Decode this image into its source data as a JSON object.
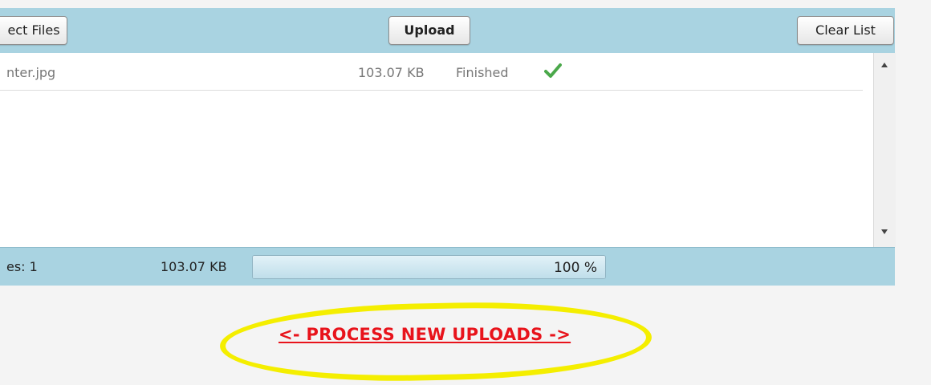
{
  "toolbar": {
    "select_files_label": "ect Files",
    "upload_label": "Upload",
    "clear_list_label": "Clear List"
  },
  "files": [
    {
      "name": "nter.jpg",
      "size": "103.07 KB",
      "status": "Finished",
      "status_icon": "check-icon"
    }
  ],
  "status_bar": {
    "file_count": "es: 1",
    "total_size": "103.07 KB",
    "progress_fraction": 1.0,
    "progress_label": "100 %"
  },
  "process_link": {
    "label": "<- PROCESS NEW UPLOADS ->"
  },
  "colors": {
    "toolbar_bg": "#a9d3e1",
    "check_green": "#4aa84a",
    "link_red": "#e8131b",
    "highlight_yellow": "#f4ee00"
  }
}
